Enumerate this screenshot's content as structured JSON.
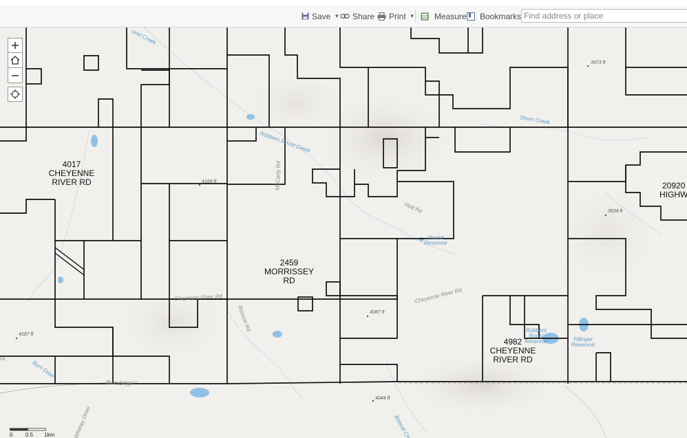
{
  "toolbar": {
    "save_label": "Save",
    "share_label": "Share",
    "print_label": "Print",
    "measure_label": "Measure",
    "bookmarks_label": "Bookmarks",
    "search_placeholder": "Find address or place"
  },
  "map": {
    "parcel_labels": {
      "p4017": [
        "4017",
        "CHEYENNE",
        "RIVER RD"
      ],
      "p2459": [
        "2459",
        "MORRISSEY",
        "RD"
      ],
      "p4982": [
        "4982",
        "CHEYENNE",
        "RIVER RD"
      ],
      "p20920": [
        "20920",
        "HIGHWA"
      ]
    },
    "road_labels": {
      "mccarty": "McCarty Rd",
      "hutt": "Hutt Rd",
      "cheyenne1": "Cheyenne River Rd",
      "cheyenne2": "Cheyenne River Rd",
      "roxson": "Roxson Rd",
      "bumdraw_road": "Bum Draw",
      "whitney": "Whitney Draw",
      "rd_partial": "rd"
    },
    "water_labels": {
      "robbers_creek": "Robbers Roost Creek",
      "roost_creek_top": "oost Creek",
      "shum_creek": "Shum Creek",
      "house_reservoir": [
        "House",
        "Reservoir"
      ],
      "robbers_reservoir": [
        "Robbers",
        "Roost",
        "Reservoir"
      ],
      "fillinger_reservoir": [
        "Fillinger",
        "Reservoir"
      ],
      "bobcat_creek": "Bobcat Creek",
      "bum_draw_creek": "Bum Draw"
    },
    "elevations": {
      "e3973": "3973 ft",
      "e4169": "4169 ft",
      "e3934": "3934 ft",
      "e4087": "4087 ft",
      "e4187": "4187 ft",
      "e4044": "4044 ft"
    },
    "scale": [
      "0",
      "0.5",
      "1km"
    ]
  },
  "colors": {
    "parcel_line": "#111111",
    "water": "#8fc1e6",
    "map_bg": "#f2f0ec",
    "toolbar_bg": "#f7f7f7"
  }
}
